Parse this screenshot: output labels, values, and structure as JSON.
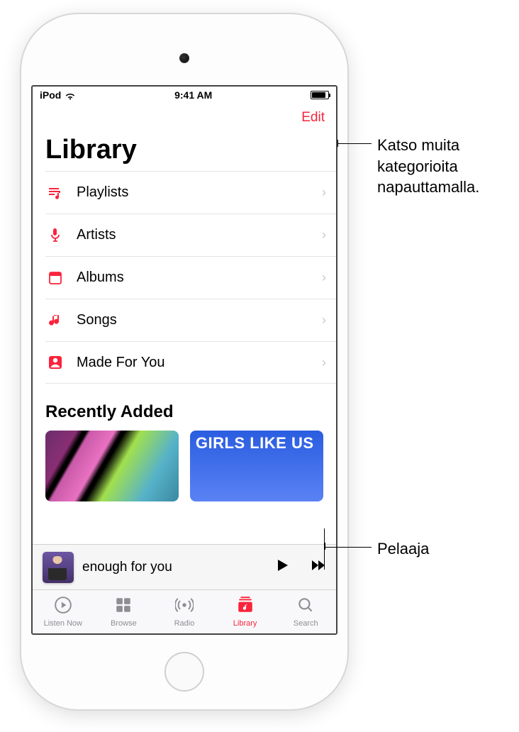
{
  "status": {
    "carrier": "iPod",
    "time": "9:41 AM"
  },
  "navbar": {
    "edit": "Edit"
  },
  "page": {
    "title": "Library"
  },
  "categories": [
    {
      "icon": "playlists",
      "label": "Playlists"
    },
    {
      "icon": "artists",
      "label": "Artists"
    },
    {
      "icon": "albums",
      "label": "Albums"
    },
    {
      "icon": "songs",
      "label": "Songs"
    },
    {
      "icon": "madeforyou",
      "label": "Made For You"
    }
  ],
  "section": {
    "recently_added": "Recently Added"
  },
  "recent_albums": [
    {
      "caption": ""
    },
    {
      "caption": "GIRLS LIKE US"
    }
  ],
  "miniplayer": {
    "track": "enough for you"
  },
  "tabs": {
    "listen_now": "Listen Now",
    "browse": "Browse",
    "radio": "Radio",
    "library": "Library",
    "search": "Search"
  },
  "callouts": {
    "edit": "Katso muita\nkategorioita\nnapauttamalla.",
    "player": "Pelaaja"
  },
  "colors": {
    "accent": "#fa233b"
  }
}
